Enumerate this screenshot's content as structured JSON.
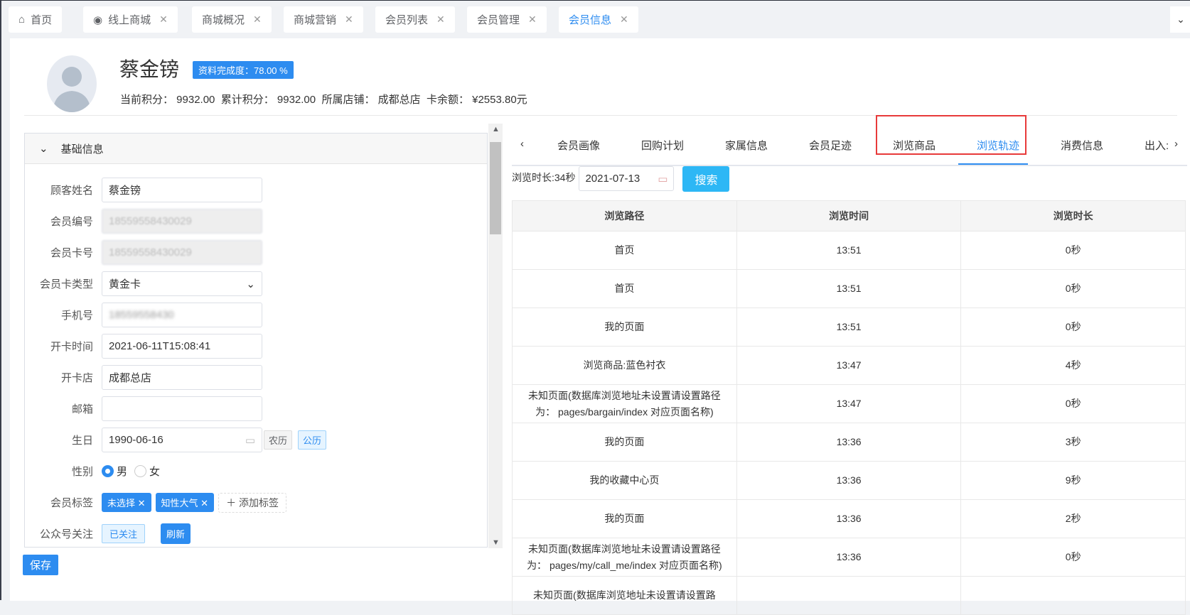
{
  "tabs": [
    {
      "label": "首页",
      "icon": "home-icon"
    },
    {
      "label": "线上商城",
      "icon": "shop-icon"
    },
    {
      "label": "商城概况"
    },
    {
      "label": "商城营销"
    },
    {
      "label": "会员列表"
    },
    {
      "label": "会员管理"
    },
    {
      "label": "会员信息",
      "active": true
    }
  ],
  "member": {
    "name": "蔡金镑",
    "completion": "资料完成度：78.00 %",
    "stats": "当前积分： 9932.00  累计积分： 9932.00  所属店铺： 成都总店  卡余额： ¥2553.80元"
  },
  "basic": {
    "title": "基础信息",
    "fields": [
      {
        "label": "顾客姓名",
        "value": "蔡金镑"
      },
      {
        "label": "会员编号",
        "value": "18559558430029"
      },
      {
        "label": "会员卡号",
        "value": "18559558430029"
      },
      {
        "label": "会员卡类型",
        "value": "黄金卡"
      },
      {
        "label": "手机号",
        "value": "18559558430"
      },
      {
        "label": "开卡时间",
        "value": "2021-06-11T15:08:41"
      },
      {
        "label": "开卡店",
        "value": "成都总店"
      },
      {
        "label": "邮箱",
        "value": ""
      },
      {
        "label": "生日",
        "value": "1990-06-16"
      }
    ],
    "lunar": "农历",
    "solar": "公历",
    "gender_label": "性别",
    "male": "男",
    "female": "女",
    "tags_label": "会员标签",
    "tags": [
      "未选择",
      "知性大气"
    ],
    "add_tag": "添加标签",
    "wechat_label": "公众号关注",
    "followed": "已关注",
    "refresh": "刷新"
  },
  "save": "保存",
  "right_tabs": [
    "会员画像",
    "回购计划",
    "家属信息",
    "会员足迹",
    "浏览商品",
    "浏览轨迹",
    "消费信息",
    "出入:"
  ],
  "search": {
    "duration": "浏览时长:34秒",
    "date": "2021-07-13",
    "button": "搜索"
  },
  "table": {
    "headers": [
      "浏览路径",
      "浏览时间",
      "浏览时长"
    ],
    "rows": [
      [
        "首页",
        "13:51",
        "0秒"
      ],
      [
        "首页",
        "13:51",
        "0秒"
      ],
      [
        "我的页面",
        "13:51",
        "0秒"
      ],
      [
        "浏览商品:蓝色衬衣",
        "13:47",
        "4秒"
      ],
      [
        "未知页面(数据库浏览地址未设置请设置路径为： pages/bargain/index 对应页面名称)",
        "13:47",
        "0秒"
      ],
      [
        "我的页面",
        "13:36",
        "3秒"
      ],
      [
        "我的收藏中心页",
        "13:36",
        "9秒"
      ],
      [
        "我的页面",
        "13:36",
        "2秒"
      ],
      [
        "未知页面(数据库浏览地址未设置请设置路径为： pages/my/call_me/index 对应页面名称)",
        "13:36",
        "0秒"
      ],
      [
        "未知页面(数据库浏览地址未设置请设置路",
        "",
        ""
      ]
    ]
  }
}
